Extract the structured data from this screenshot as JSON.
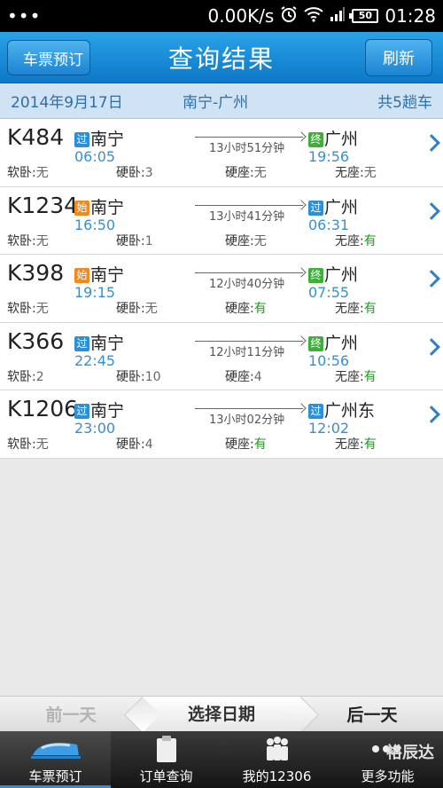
{
  "status_bar": {
    "dots": "•••",
    "speed": "0.00K/s",
    "battery": "50",
    "time": "01:28"
  },
  "header": {
    "back_label": "车票预订",
    "title": "查询结果",
    "refresh_label": "刷新"
  },
  "subheader": {
    "date": "2014年9月17日",
    "route": "南宁-广州",
    "count": "共5趟车"
  },
  "trains": [
    {
      "no": "K484",
      "dep_tag": "过",
      "dep_tag_type": "pass",
      "dep_station": "南宁",
      "dep_time": "06:05",
      "duration": "13小时51分钟",
      "arr_tag": "终",
      "arr_tag_type": "end",
      "arr_station": "广州",
      "arr_time": "19:56",
      "seats": {
        "soft_label": "软卧:",
        "soft": "无",
        "hard_label": "硬卧:",
        "hard": "3",
        "seat_label": "硬座:",
        "seat": "无",
        "none_label": "无座:",
        "none": "无"
      }
    },
    {
      "no": "K1234",
      "dep_tag": "始",
      "dep_tag_type": "start",
      "dep_station": "南宁",
      "dep_time": "16:50",
      "duration": "13小时41分钟",
      "arr_tag": "过",
      "arr_tag_type": "pass",
      "arr_station": "广州",
      "arr_time": "06:31",
      "seats": {
        "soft_label": "软卧:",
        "soft": "无",
        "hard_label": "硬卧:",
        "hard": "1",
        "seat_label": "硬座:",
        "seat": "无",
        "none_label": "无座:",
        "none": "有"
      }
    },
    {
      "no": "K398",
      "dep_tag": "始",
      "dep_tag_type": "start",
      "dep_station": "南宁",
      "dep_time": "19:15",
      "duration": "12小时40分钟",
      "arr_tag": "终",
      "arr_tag_type": "end",
      "arr_station": "广州",
      "arr_time": "07:55",
      "seats": {
        "soft_label": "软卧:",
        "soft": "无",
        "hard_label": "硬卧:",
        "hard": "无",
        "seat_label": "硬座:",
        "seat": "有",
        "none_label": "无座:",
        "none": "有"
      }
    },
    {
      "no": "K366",
      "dep_tag": "过",
      "dep_tag_type": "pass",
      "dep_station": "南宁",
      "dep_time": "22:45",
      "duration": "12小时11分钟",
      "arr_tag": "终",
      "arr_tag_type": "end",
      "arr_station": "广州",
      "arr_time": "10:56",
      "seats": {
        "soft_label": "软卧:",
        "soft": "2",
        "hard_label": "硬卧:",
        "hard": "10",
        "seat_label": "硬座:",
        "seat": "4",
        "none_label": "无座:",
        "none": "有"
      }
    },
    {
      "no": "K1206",
      "dep_tag": "过",
      "dep_tag_type": "pass",
      "dep_station": "南宁",
      "dep_time": "23:00",
      "duration": "13小时02分钟",
      "arr_tag": "过",
      "arr_tag_type": "pass",
      "arr_station": "广州东",
      "arr_time": "12:02",
      "seats": {
        "soft_label": "软卧:",
        "soft": "无",
        "hard_label": "硬卧:",
        "hard": "4",
        "seat_label": "硬座:",
        "seat": "有",
        "none_label": "无座:",
        "none": "有"
      }
    }
  ],
  "date_bar": {
    "prev": "前一天",
    "pick": "选择日期",
    "next": "后一天"
  },
  "bottom_nav": {
    "items": [
      {
        "label": "车票预订",
        "icon": "train-icon"
      },
      {
        "label": "订单查询",
        "icon": "clipboard-icon"
      },
      {
        "label": "我的12306",
        "icon": "people-icon"
      },
      {
        "label": "更多功能",
        "icon": "more-dots-icon"
      }
    ],
    "watermark": "裕辰达"
  },
  "colors": {
    "accent": "#1b84d2",
    "available": "#1f9a1f",
    "time": "#3a8fd0",
    "tag_pass": "#2f8fd6",
    "tag_start": "#f08a1c",
    "tag_end": "#3fae3a"
  }
}
